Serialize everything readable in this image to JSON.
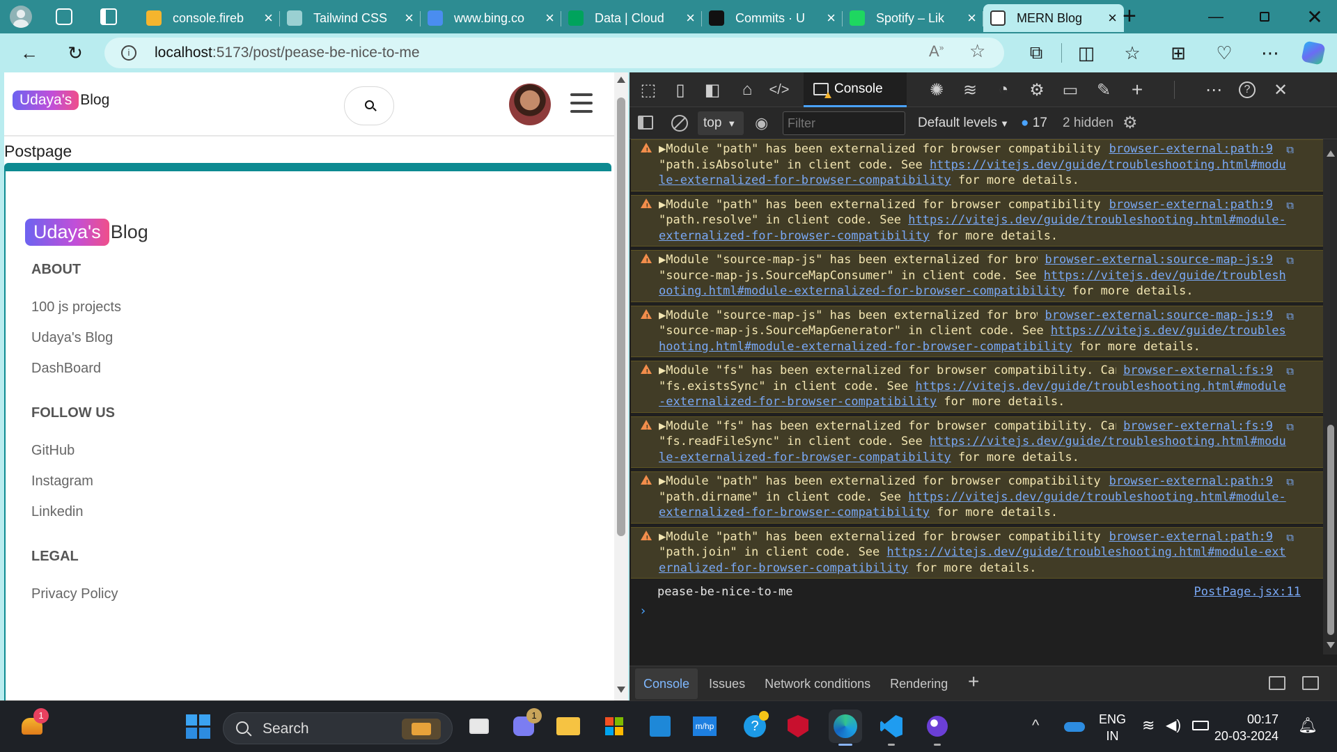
{
  "browser": {
    "tabs": [
      {
        "title": "console.fireb",
        "icon": "firebase-icon",
        "color": "#f5b52e"
      },
      {
        "title": "Tailwind CSS",
        "icon": "chatgpt-icon",
        "color": "#9ad0d2"
      },
      {
        "title": "www.bing.co",
        "icon": "bing-search-icon",
        "color": "#4a8df0"
      },
      {
        "title": "Data | Cloud",
        "icon": "mongodb-leaf-icon",
        "color": "#00a35c"
      },
      {
        "title": "Commits · U",
        "icon": "github-icon",
        "color": "#111111"
      },
      {
        "title": "Spotify – Lik",
        "icon": "spotify-icon",
        "color": "#1ed760"
      },
      {
        "title": "MERN Blog",
        "icon": "page-icon",
        "color": "#ffffff",
        "active": true
      }
    ],
    "url_host": "localhost",
    "url_path": ":5173/post/pease-be-nice-to-me"
  },
  "page": {
    "header_logo_pill": "Udaya's",
    "header_logo_text": "Blog",
    "breadcrumb": "Postpage",
    "sidebar_logo_pill": "Udaya's",
    "sidebar_logo_text": "Blog",
    "sections": [
      {
        "heading": "ABOUT",
        "items": [
          "100 js projects",
          "Udaya's Blog",
          "DashBoard"
        ]
      },
      {
        "heading": "FOLLOW US",
        "items": [
          "GitHub",
          "Instagram",
          "Linkedin"
        ]
      },
      {
        "heading": "LEGAL",
        "items": [
          "Privacy Policy"
        ]
      }
    ]
  },
  "devtools": {
    "active_tab": "Console",
    "context": "top",
    "filter_placeholder": "Filter",
    "levels": "Default levels",
    "msg_count": "17",
    "hidden": "2 hidden",
    "messages": [
      {
        "text": "▶Module \"path\" has been externalized for browser compatibility. Cannot access \"path.isAbsolute\" in client code. See ",
        "link": "https://vitejs.dev/guide/troubleshooting.html#module-externalized-for-browser-compatibility",
        "tail": " for more details.",
        "src": "browser-external:path:9"
      },
      {
        "text": "▶Module \"path\" has been externalized for browser compatibility. Cannot access \"path.resolve\" in client code. See ",
        "link": "https://vitejs.dev/guide/troubleshooting.html#module-externalized-for-browser-compatibility",
        "tail": " for more details.",
        "src": "browser-external:path:9"
      },
      {
        "text": "▶Module \"source-map-js\" has been externalized for browser compatibility. Cannot access \"source-map-js.SourceMapConsumer\" in client code. See ",
        "link": "https://vitejs.dev/guide/troubleshooting.html#module-externalized-for-browser-compatibility",
        "tail": " for more details.",
        "src": "browser-external:source-map-js:9"
      },
      {
        "text": "▶Module \"source-map-js\" has been externalized for browser compatibility. Cannot access \"source-map-js.SourceMapGenerator\" in client code. See ",
        "link": "https://vitejs.dev/guide/troubleshooting.html#module-externalized-for-browser-compatibility",
        "tail": " for more details.",
        "src": "browser-external:source-map-js:9"
      },
      {
        "text": "▶Module \"fs\" has been externalized for browser compatibility. Cannot access \"fs.existsSync\" in client code. See ",
        "link": "https://vitejs.dev/guide/troubleshooting.html#module-externalized-for-browser-compatibility",
        "tail": " for more details.",
        "src": "browser-external:fs:9"
      },
      {
        "text": "▶Module \"fs\" has been externalized for browser compatibility. Cannot access \"fs.readFileSync\" in client code. See ",
        "link": "https://vitejs.dev/guide/troubleshooting.html#module-externalized-for-browser-compatibility",
        "tail": " for more details.",
        "src": "browser-external:fs:9"
      },
      {
        "text": "▶Module \"path\" has been externalized for browser compatibility. Cannot access \"path.dirname\" in client code. See ",
        "link": "https://vitejs.dev/guide/troubleshooting.html#module-externalized-for-browser-compatibility",
        "tail": " for more details.",
        "src": "browser-external:path:9"
      },
      {
        "text": "▶Module \"path\" has been externalized for browser compatibility. Cannot access \"path.join\" in client code. See ",
        "link": "https://vitejs.dev/guide/troubleshooting.html#module-externalized-for-browser-compatibility",
        "tail": " for more details.",
        "src": "browser-external:path:9"
      }
    ],
    "log_text": "pease-be-nice-to-me",
    "log_src": "PostPage.jsx:11",
    "bottom_tabs": [
      "Console",
      "Issues",
      "Network conditions",
      "Rendering"
    ]
  },
  "taskbar": {
    "search": "Search",
    "lang_top": "ENG",
    "lang_bottom": "IN",
    "time": "00:17",
    "date": "20-03-2024",
    "badge_weather": "1",
    "badge_teams": "1"
  },
  "colors": {
    "accent": "#2d8c92",
    "warning_bg": "#413c26",
    "link": "#79a8f5"
  }
}
